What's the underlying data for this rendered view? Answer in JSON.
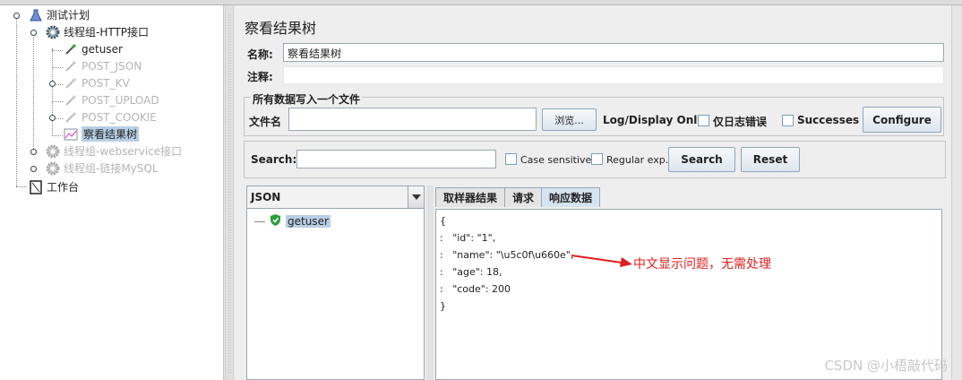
{
  "tree": {
    "root": "测试计划",
    "items": [
      {
        "label": "线程组-HTTP接口",
        "disabled": false
      },
      {
        "label": "getuser",
        "disabled": false
      },
      {
        "label": "POST_JSON",
        "disabled": true
      },
      {
        "label": "POST_KV",
        "disabled": true
      },
      {
        "label": "POST_UPLOAD",
        "disabled": true
      },
      {
        "label": "POST_COOKIE",
        "disabled": true
      },
      {
        "label": "察看结果树",
        "disabled": false,
        "selected": true
      },
      {
        "label": "线程组-webservice接口",
        "disabled": true
      },
      {
        "label": "线程组-链接MySQL",
        "disabled": true
      },
      {
        "label": "工作台",
        "disabled": false
      }
    ]
  },
  "panel": {
    "title": "察看结果树",
    "name_label": "名称:",
    "name_value": "察看结果树",
    "comment_label": "注释:",
    "comment_value": "",
    "file_group_title": "所有数据写入一个文件",
    "filename_label": "文件名",
    "filename_value": "",
    "browse_label": "浏览...",
    "log_display_label": "Log/Display Only:",
    "errors_only_label": "仅日志错误",
    "successes_label": "Successes",
    "configure_label": "Configure",
    "search_label": "Search:",
    "search_value": "",
    "case_sensitive_label": "Case sensitive",
    "regex_label": "Regular exp.",
    "search_button": "Search",
    "reset_button": "Reset"
  },
  "results": {
    "renderer": "JSON",
    "samples": [
      {
        "label": "getuser",
        "status": "success"
      }
    ],
    "tabs": [
      {
        "label": "取样器结果",
        "active": false
      },
      {
        "label": "请求",
        "active": false
      },
      {
        "label": "响应数据",
        "active": true
      }
    ],
    "response_lines": [
      "{",
      ":   \"id\": \"1\",",
      ":   \"name\": \"\\u5c0f\\u660e\",",
      ":   \"age\": 18,",
      ":   \"code\": 200",
      "}"
    ]
  },
  "annotation": "中文显示问题，无需处理",
  "watermark": "CSDN @小梧敲代码",
  "colors": {
    "annotation": "#e02020",
    "selected_bg": "#b8cfe5",
    "active_tab": "#d6e3f0"
  }
}
